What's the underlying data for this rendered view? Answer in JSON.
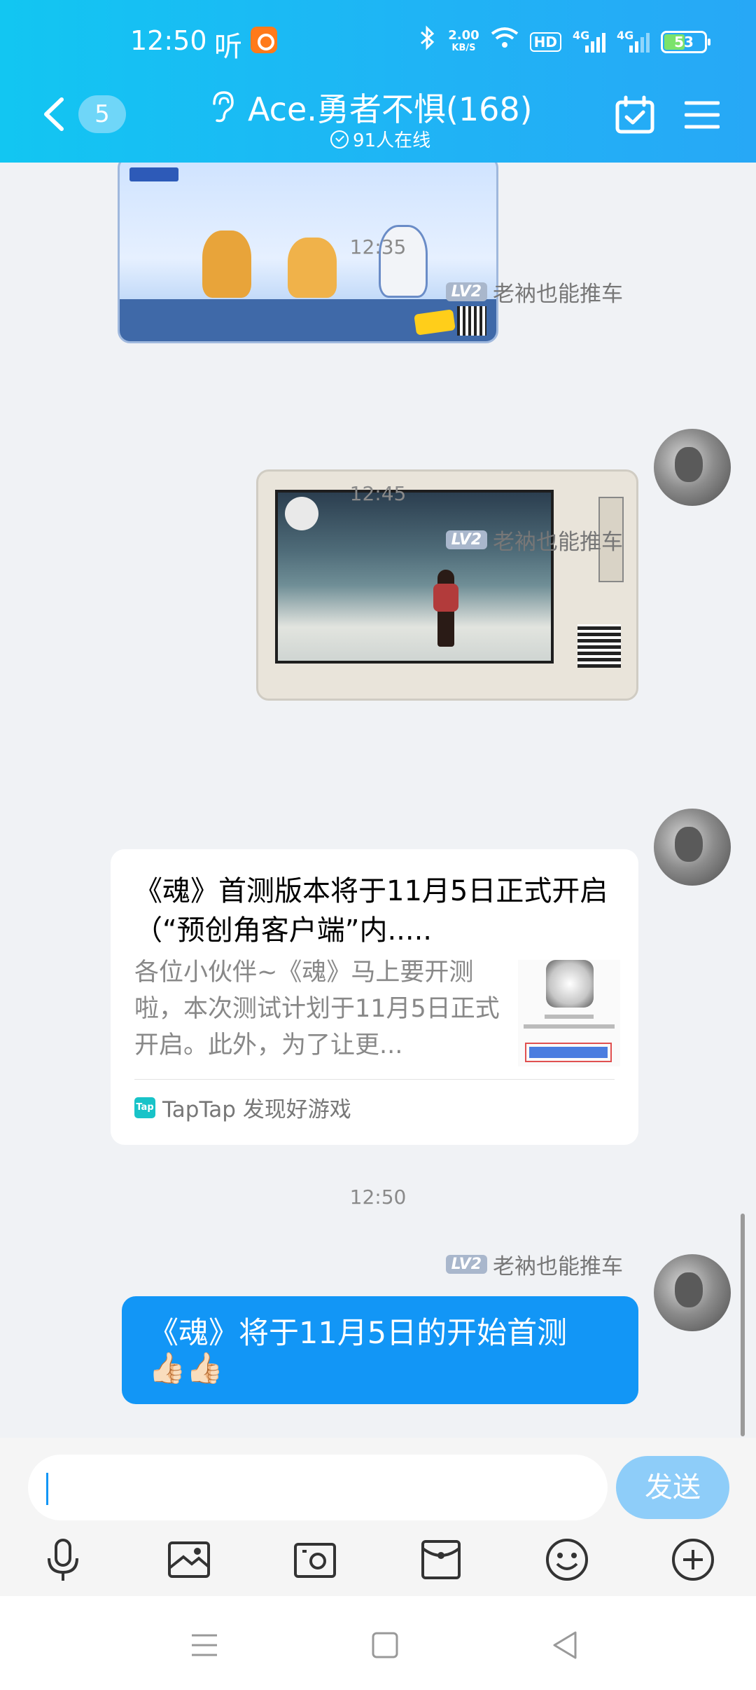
{
  "status_bar": {
    "time": "12:50",
    "listen_label": "听",
    "net_speed_value": "2.00",
    "net_speed_unit": "KB/S",
    "hd_label": "HD",
    "signal1_label": "4G",
    "signal2_label": "4G",
    "battery_level": "53"
  },
  "header": {
    "unread_count": "5",
    "group_title": "Ace.勇者不惧(168)",
    "online_text": "91人在线"
  },
  "messages": {
    "time1": "12:35",
    "time2": "12:45",
    "time3": "12:50",
    "sender_level": "LV2",
    "sender_name": "老衲也能推车",
    "card": {
      "title": "《魂》首测版本将于11月5日正式开启（“预创角客户端”内.....",
      "description": "各位小伙伴~《魂》马上要开测啦，本次测试计划于11月5日正式开启。此外，为了让更...",
      "source_icon": "Tap",
      "source": "TapTap 发现好游戏"
    },
    "text_message": "《魂》将于11月5日的开始首测",
    "text_emoji": "👍🏻👍🏻"
  },
  "input_bar": {
    "value": "",
    "send_label": "发送"
  },
  "colors": {
    "header_gradient_start": "#12c6f2",
    "header_gradient_end": "#27a8f6",
    "bubble_blue": "#1296f6",
    "send_button": "#8ecdf9",
    "chat_background": "#f0f2f5"
  },
  "icons": {
    "back": "chevron-left-icon",
    "ear": "ear-icon",
    "calendar": "calendar-check-icon",
    "menu": "hamburger-menu-icon",
    "mic": "microphone-icon",
    "image": "image-icon",
    "camera": "camera-icon",
    "red_packet": "red-packet-icon",
    "emoji": "smiley-icon",
    "plus": "plus-circle-icon"
  }
}
